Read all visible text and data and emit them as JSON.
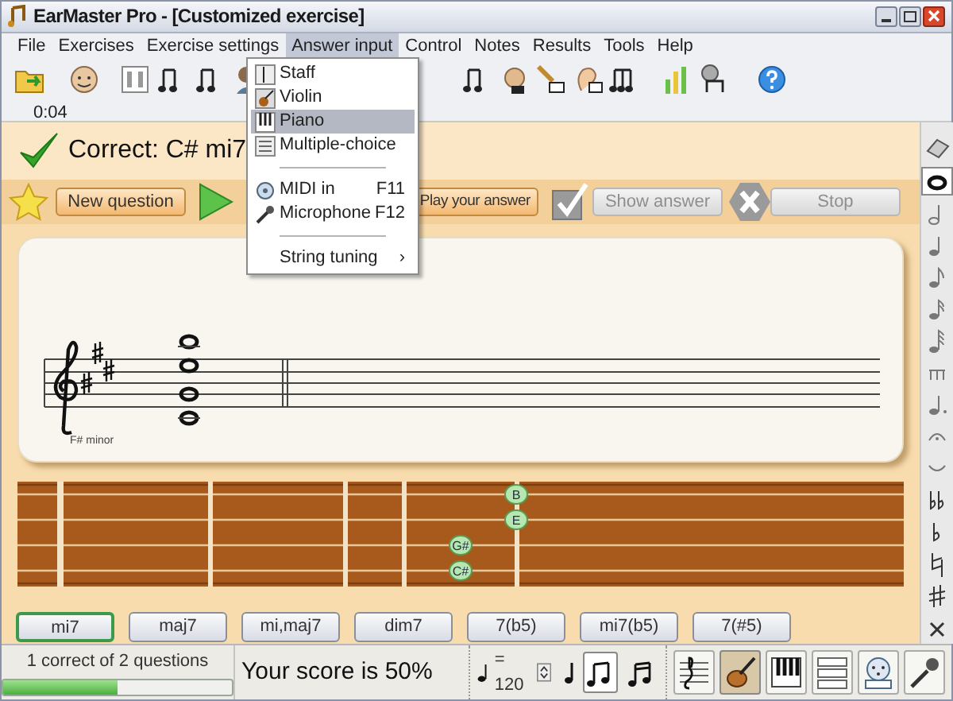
{
  "window": {
    "title": "EarMaster Pro - [Customized exercise]"
  },
  "menu": [
    {
      "label": "File",
      "selected": false
    },
    {
      "label": "Exercises",
      "selected": false
    },
    {
      "label": "Exercise settings",
      "selected": false
    },
    {
      "label": "Answer input",
      "selected": true
    },
    {
      "label": "Control",
      "selected": false
    },
    {
      "label": "Notes",
      "selected": false
    },
    {
      "label": "Results",
      "selected": false
    },
    {
      "label": "Tools",
      "selected": false
    },
    {
      "label": "Help",
      "selected": false
    }
  ],
  "toolbar": {
    "time": "0:04"
  },
  "dropdown": [
    {
      "kind": "item",
      "label": "Staff",
      "selected": false
    },
    {
      "kind": "item",
      "label": "Violin",
      "selected": false
    },
    {
      "kind": "item",
      "label": "Piano",
      "selected": true
    },
    {
      "kind": "item",
      "label": "Multiple-choice",
      "selected": false
    },
    {
      "kind": "separator"
    },
    {
      "kind": "item",
      "label": "MIDI in",
      "shortcut": "F11",
      "selected": false
    },
    {
      "kind": "item",
      "label": "Microphone",
      "shortcut": "F12",
      "selected": false
    },
    {
      "kind": "separator"
    },
    {
      "kind": "submenu",
      "label": "String tuning",
      "arrow": "›",
      "selected": false
    }
  ],
  "result": {
    "text": "Correct: C# mi7"
  },
  "buttons": [
    {
      "label": "New question",
      "disabled": false
    },
    {
      "label": "Play your answer",
      "disabled": false
    },
    {
      "label": "Show answer",
      "disabled": true
    },
    {
      "label": "Stop",
      "disabled": true
    }
  ],
  "staff": {
    "key_label": "F# minor"
  },
  "fretboard": {
    "notes": [
      {
        "label": "B"
      },
      {
        "label": "E"
      },
      {
        "label": "G#"
      },
      {
        "label": "C#"
      }
    ]
  },
  "answers": [
    {
      "label": "mi7",
      "selected": true
    },
    {
      "label": "maj7",
      "selected": false
    },
    {
      "label": "mi,maj7",
      "selected": false
    },
    {
      "label": "dim7",
      "selected": false
    },
    {
      "label": "7(b5)",
      "selected": false
    },
    {
      "label": "mi7(b5)",
      "selected": false
    },
    {
      "label": "7(#5)",
      "selected": false
    }
  ],
  "status_bar": {
    "progress_text": "1 correct of 2 questions",
    "level": 0.5,
    "score": "Your score is 50%",
    "tempo": "= 120",
    "rhythm_toggles": [
      {
        "selected": false
      },
      {
        "selected": true
      },
      {
        "selected": false
      }
    ],
    "input_toggles": [
      {
        "selected": false
      },
      {
        "selected": true
      },
      {
        "selected": false
      },
      {
        "selected": false
      },
      {
        "selected": false
      },
      {
        "selected": false
      }
    ]
  }
}
